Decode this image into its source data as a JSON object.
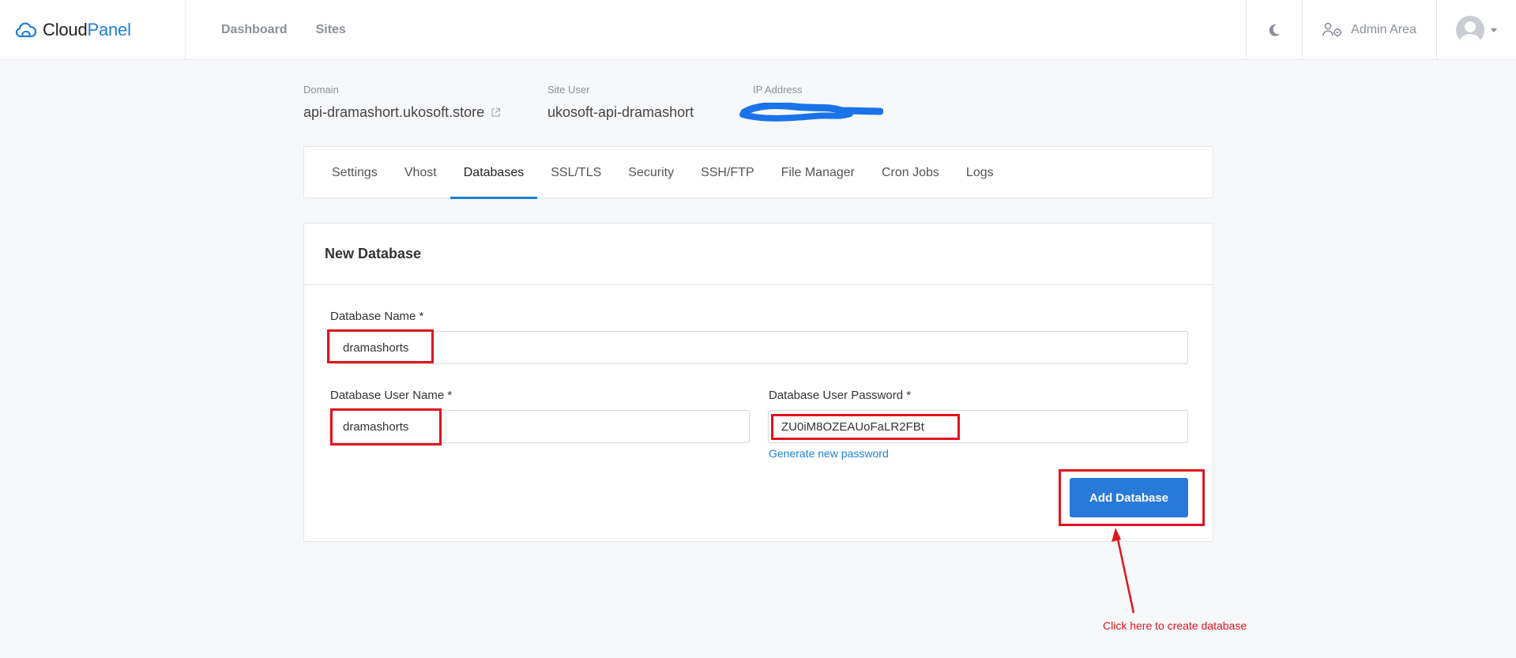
{
  "brand": {
    "part1": "Cloud",
    "part2": "Panel"
  },
  "topnav": {
    "dashboard": "Dashboard",
    "sites": "Sites"
  },
  "topbar": {
    "admin_area": "Admin Area"
  },
  "site": {
    "domain_label": "Domain",
    "domain_value": "api-dramashort.ukosoft.store",
    "user_label": "Site User",
    "user_value": "ukosoft-api-dramashort",
    "ip_label": "IP Address"
  },
  "tabs": [
    "Settings",
    "Vhost",
    "Databases",
    "SSL/TLS",
    "Security",
    "SSH/FTP",
    "File Manager",
    "Cron Jobs",
    "Logs"
  ],
  "form": {
    "title": "New Database",
    "db_name_label": "Database Name *",
    "db_name_value": "dramashorts",
    "db_user_label": "Database User Name *",
    "db_user_value": "dramashorts",
    "db_pass_label": "Database User Password *",
    "db_pass_value": "ZU0iM8OZEAUoFaLR2FBt",
    "generate_link": "Generate new password",
    "submit": "Add Database"
  },
  "annotation": {
    "text": "Click here to create database"
  },
  "colors": {
    "accent": "#1f7fd6",
    "button": "#2979d9",
    "highlight": "#e0141e"
  }
}
